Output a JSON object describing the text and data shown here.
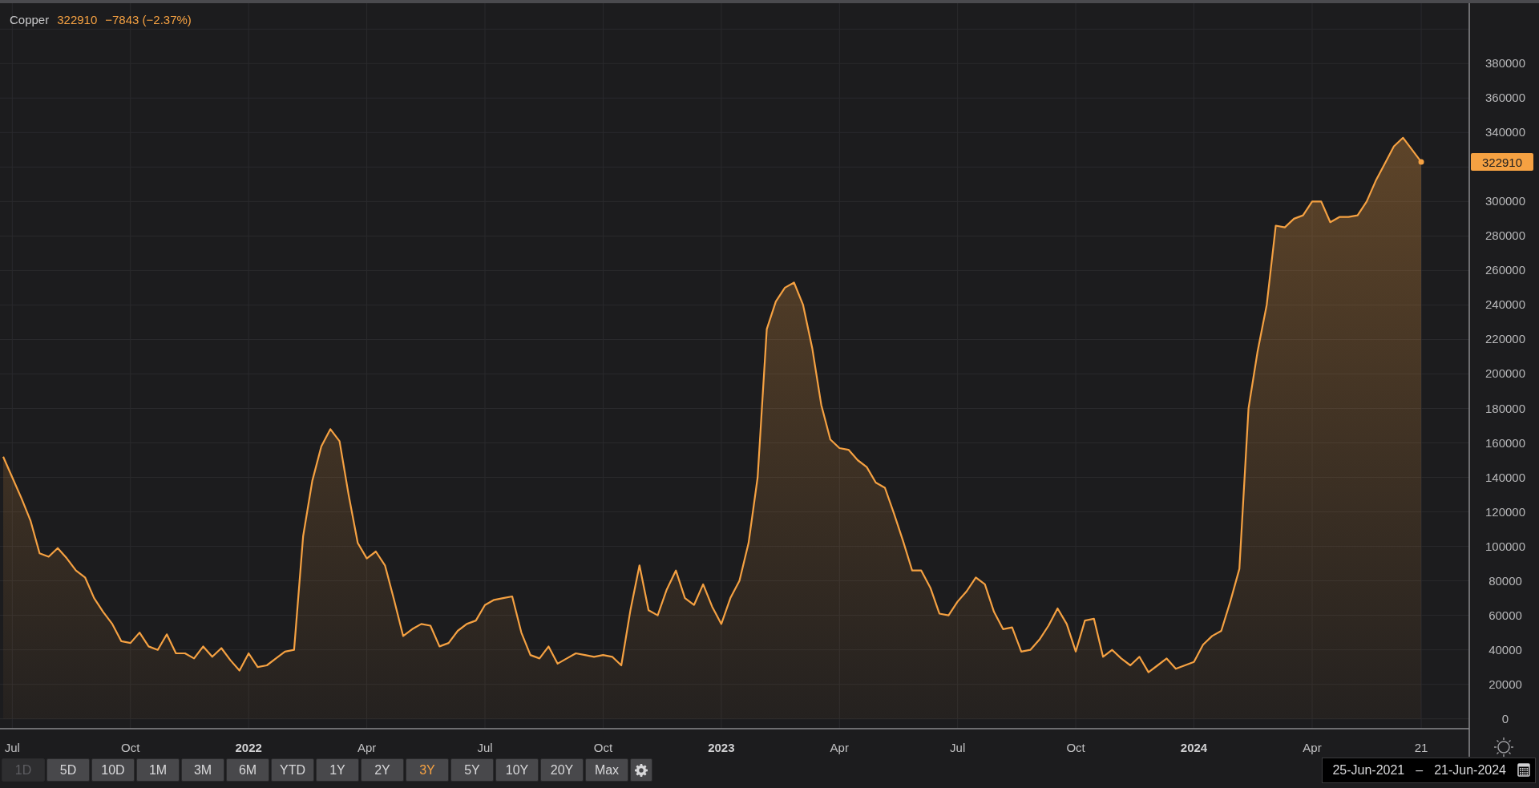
{
  "legend": {
    "value": "322910",
    "change": "−7843 (−2.37%)"
  },
  "chart_data": {
    "type": "area",
    "grid": true,
    "ylim": [
      0,
      415000
    ],
    "categories": [
      null,
      "Jul",
      null,
      null,
      null,
      null,
      null,
      null,
      null,
      null,
      null,
      null,
      null,
      null,
      "Oct",
      null,
      null,
      null,
      null,
      null,
      null,
      null,
      null,
      null,
      null,
      null,
      null,
      "2022",
      null,
      null,
      null,
      null,
      null,
      null,
      null,
      null,
      null,
      null,
      null,
      null,
      "Apr",
      null,
      null,
      null,
      null,
      null,
      null,
      null,
      null,
      null,
      null,
      null,
      null,
      "Jul",
      null,
      null,
      null,
      null,
      null,
      null,
      null,
      null,
      null,
      null,
      null,
      null,
      "Oct",
      null,
      null,
      null,
      null,
      null,
      null,
      null,
      null,
      null,
      null,
      null,
      null,
      "2023",
      null,
      null,
      null,
      null,
      null,
      null,
      null,
      null,
      null,
      null,
      null,
      null,
      "Apr",
      null,
      null,
      null,
      null,
      null,
      null,
      null,
      null,
      null,
      null,
      null,
      null,
      "Jul",
      null,
      null,
      null,
      null,
      null,
      null,
      null,
      null,
      null,
      null,
      null,
      null,
      "Oct",
      null,
      null,
      null,
      null,
      null,
      null,
      null,
      null,
      null,
      null,
      null,
      null,
      "2024",
      null,
      null,
      null,
      null,
      null,
      null,
      null,
      null,
      null,
      null,
      null,
      null,
      "Apr",
      null,
      null,
      null,
      null,
      null,
      null,
      null,
      null,
      null,
      null,
      null,
      "21"
    ],
    "yticks": [
      0,
      20000,
      40000,
      60000,
      80000,
      100000,
      120000,
      140000,
      160000,
      180000,
      200000,
      220000,
      240000,
      260000,
      280000,
      300000,
      340000,
      360000,
      380000
    ],
    "series": [
      {
        "name": "Copper",
        "color": "#f5a142",
        "values": [
          152000,
          140000,
          128000,
          115000,
          96000,
          94000,
          99000,
          93000,
          86000,
          82000,
          70000,
          62000,
          55000,
          45000,
          44000,
          50000,
          42000,
          40000,
          49000,
          38000,
          38000,
          35000,
          42000,
          36000,
          41000,
          34000,
          28000,
          38000,
          30000,
          31000,
          35000,
          39000,
          40000,
          106000,
          138000,
          158000,
          168000,
          161000,
          130000,
          102000,
          93000,
          97000,
          89000,
          69000,
          48000,
          52000,
          55000,
          54000,
          42000,
          44000,
          51000,
          55000,
          57000,
          66000,
          69000,
          70000,
          71000,
          50000,
          37000,
          35000,
          42000,
          32000,
          35000,
          38000,
          37000,
          36000,
          37000,
          36000,
          31000,
          63000,
          89000,
          63000,
          60000,
          75000,
          86000,
          70000,
          66000,
          78000,
          65000,
          55000,
          70000,
          80000,
          102000,
          140000,
          226000,
          242000,
          250000,
          253000,
          240000,
          215000,
          182000,
          162000,
          157000,
          156000,
          150000,
          146000,
          137000,
          134000,
          119000,
          103000,
          86000,
          86000,
          76000,
          61000,
          60000,
          68000,
          74000,
          82000,
          78000,
          62000,
          52000,
          53000,
          39000,
          40000,
          46000,
          54000,
          64000,
          55000,
          39000,
          57000,
          58000,
          36000,
          40000,
          35000,
          31000,
          36000,
          27000,
          31000,
          35000,
          29000,
          31000,
          33000,
          43000,
          48000,
          51000,
          68000,
          87000,
          180000,
          213000,
          240000,
          286000,
          285000,
          290000,
          292000,
          300000,
          300000,
          288000,
          291000,
          291000,
          292000,
          300000,
          312000,
          322000,
          332000,
          337000,
          330000,
          323000
        ]
      }
    ]
  },
  "last_value_tag": "322910",
  "ranges": [
    {
      "label": "1D",
      "selected": false,
      "disabled": true
    },
    {
      "label": "5D",
      "selected": false,
      "disabled": false
    },
    {
      "label": "10D",
      "selected": false,
      "disabled": false
    },
    {
      "label": "1M",
      "selected": false,
      "disabled": false
    },
    {
      "label": "3M",
      "selected": false,
      "disabled": false
    },
    {
      "label": "6M",
      "selected": false,
      "disabled": false
    },
    {
      "label": "YTD",
      "selected": false,
      "disabled": false
    },
    {
      "label": "1Y",
      "selected": false,
      "disabled": false
    },
    {
      "label": "2Y",
      "selected": false,
      "disabled": false
    },
    {
      "label": "3Y",
      "selected": true,
      "disabled": false
    },
    {
      "label": "5Y",
      "selected": false,
      "disabled": false
    },
    {
      "label": "10Y",
      "selected": false,
      "disabled": false
    },
    {
      "label": "20Y",
      "selected": false,
      "disabled": false
    },
    {
      "label": "Max",
      "selected": false,
      "disabled": false
    }
  ],
  "date_range": {
    "start": "25-Jun-2021",
    "separator": "–",
    "end": "21-Jun-2024"
  }
}
